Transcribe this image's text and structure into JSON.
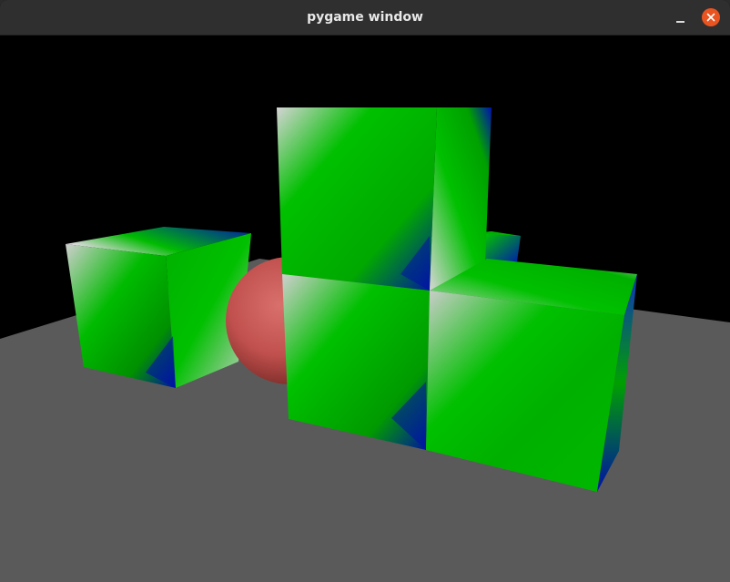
{
  "window": {
    "title": "pygame window",
    "close_color": "#e95420"
  },
  "scene": {
    "background_color": "#000000",
    "floor_color": "#5a5a5a",
    "sphere_color": "#c0504d",
    "cube_colors": [
      "#00bb00",
      "#0000aa",
      "#cfcfcf"
    ],
    "objects": [
      "cube",
      "cube",
      "cube",
      "cube",
      "cube",
      "sphere"
    ]
  }
}
